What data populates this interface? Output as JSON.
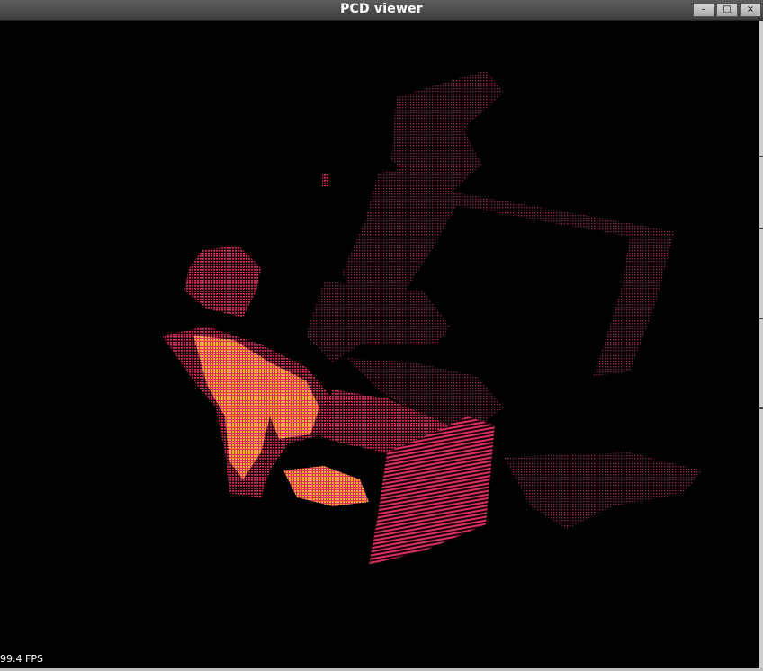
{
  "window": {
    "title": "PCD viewer",
    "controls": {
      "minimize": "–",
      "maximize": "□",
      "close": "×"
    }
  },
  "viewer": {
    "fps_text": "99.4 FPS",
    "background_color": "#000000",
    "point_colors": [
      "#d8315b",
      "#8e2a47",
      "#f0b030"
    ]
  }
}
